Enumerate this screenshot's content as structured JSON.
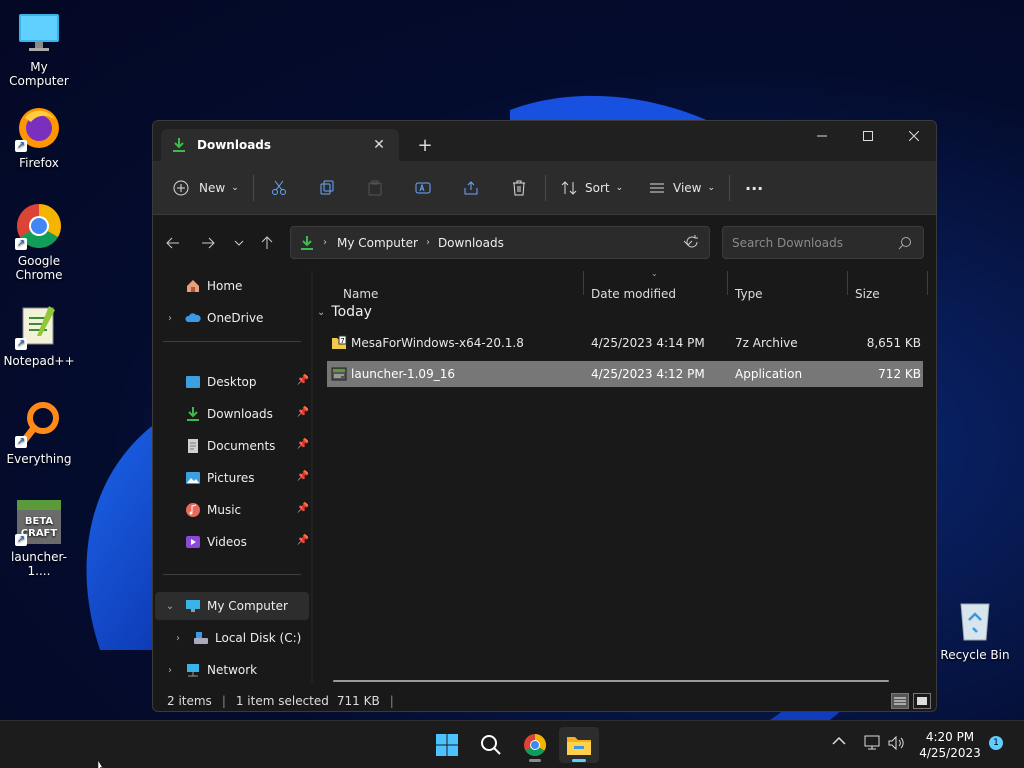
{
  "desktop": {
    "icons": [
      {
        "label": "My Computer"
      },
      {
        "label": "Firefox"
      },
      {
        "label": "Google Chrome"
      },
      {
        "label": "Notepad++"
      },
      {
        "label": "Everything"
      },
      {
        "label": "launcher-1...."
      },
      {
        "label": "Recycle Bin"
      }
    ],
    "beta_craft_text": [
      "BETA",
      "CRAFT"
    ]
  },
  "explorer": {
    "tab": {
      "title": "Downloads",
      "close_symbol": "✕"
    },
    "new_tab_symbol": "+",
    "toolbar": {
      "new_label": "New",
      "sort_label": "Sort",
      "view_label": "View",
      "more_symbol": "···"
    },
    "breadcrumb": [
      "My Computer",
      "Downloads"
    ],
    "search": {
      "placeholder": "Search Downloads"
    },
    "sidebar": {
      "home": "Home",
      "onedrive": "OneDrive",
      "quick": [
        "Desktop",
        "Downloads",
        "Documents",
        "Pictures",
        "Music",
        "Videos"
      ],
      "my_computer": "My Computer",
      "local_disk": "Local Disk (C:)",
      "network": "Network"
    },
    "columns": {
      "name": "Name",
      "date": "Date modified",
      "type": "Type",
      "size": "Size"
    },
    "group": "Today",
    "files": [
      {
        "name": "MesaForWindows-x64-20.1.8",
        "date": "4/25/2023 4:14 PM",
        "type": "7z Archive",
        "size": "8,651 KB",
        "selected": false
      },
      {
        "name": "launcher-1.09_16",
        "date": "4/25/2023 4:12 PM",
        "type": "Application",
        "size": "712 KB",
        "selected": true
      }
    ],
    "status": {
      "items": "2 items",
      "selected": "1 item selected",
      "size": "711 KB"
    }
  },
  "taskbar": {
    "time": "4:20 PM",
    "date": "4/25/2023",
    "notification_count": "1"
  },
  "colors": {
    "accent": "#60cdff",
    "selection": "#777777",
    "folder_green": "#3fb950"
  }
}
